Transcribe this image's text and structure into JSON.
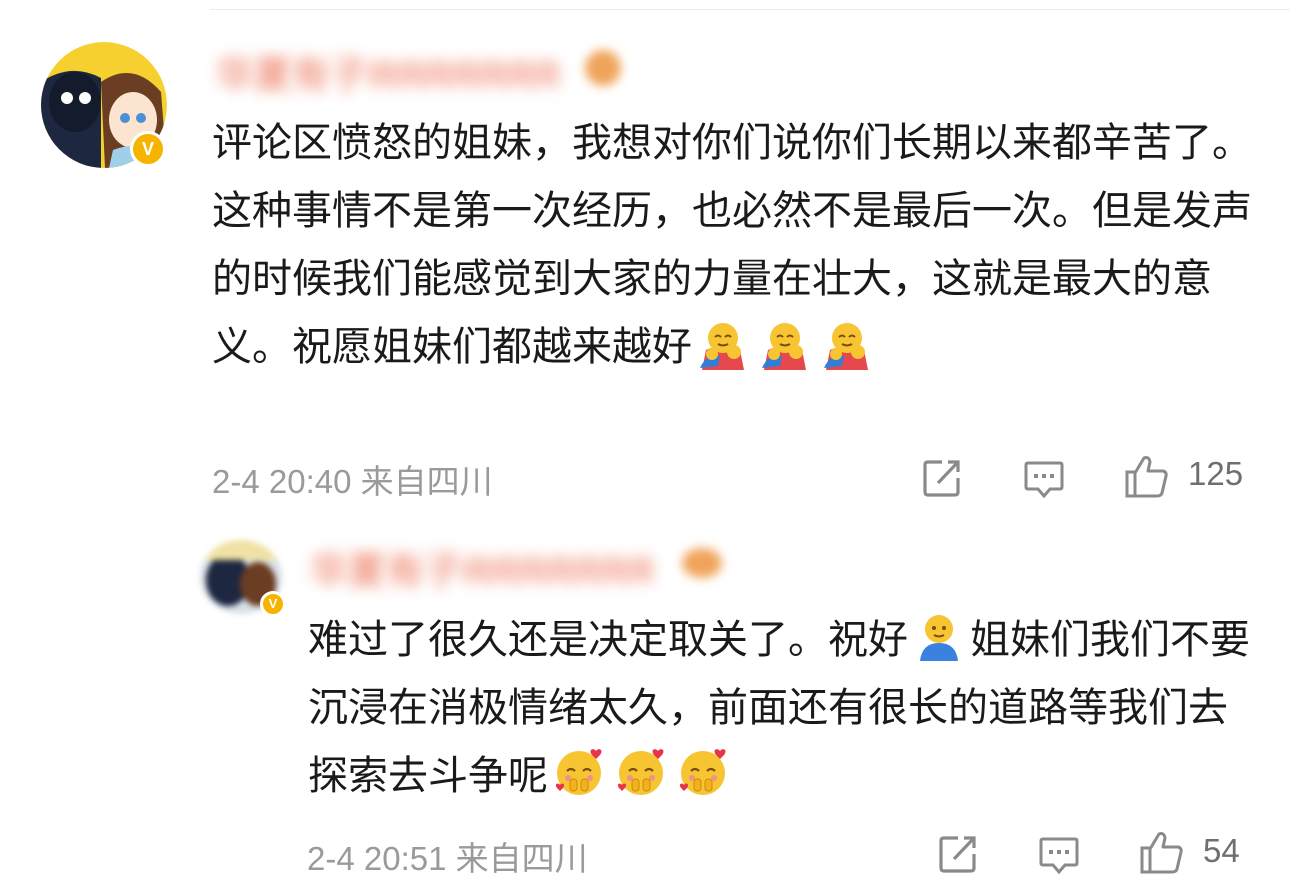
{
  "comments": [
    {
      "username": "华夏有子ЯЯЯЯЯЯЯ",
      "text": "评论区愤怒的姐妹，我想对你们说你们长期以来都辛苦了。这种事情不是第一次经历，也必然不是最后一次。但是发声的时候我们能感觉到大家的力量在壮大，这就是最大的意义。祝愿姐妹们都越来越好",
      "emojis": [
        "hug-emoji",
        "hug-emoji",
        "hug-emoji"
      ],
      "timestamp": "2-4 20:40 来自四川",
      "like_count": "125",
      "verified_badge": "V"
    },
    {
      "username": "华夏有子ЯЯЯЯЯЯЯ",
      "text_part1": "难过了很久还是决定取关了。祝好",
      "text_part2": "姐妹们我们不要沉浸在消极情绪太久，前面还有很长的道路等我们去探索去斗争呢",
      "emojis": [
        "person-blue-emoji",
        "love-face-emoji",
        "love-face-emoji",
        "love-face-emoji"
      ],
      "timestamp": "2-4 20:51 来自四川",
      "like_count": "54",
      "verified_badge": "V"
    }
  ],
  "colors": {
    "verified": "#f6b400",
    "meta_text": "#9a9a9a",
    "icon": "#8a8a8a"
  }
}
